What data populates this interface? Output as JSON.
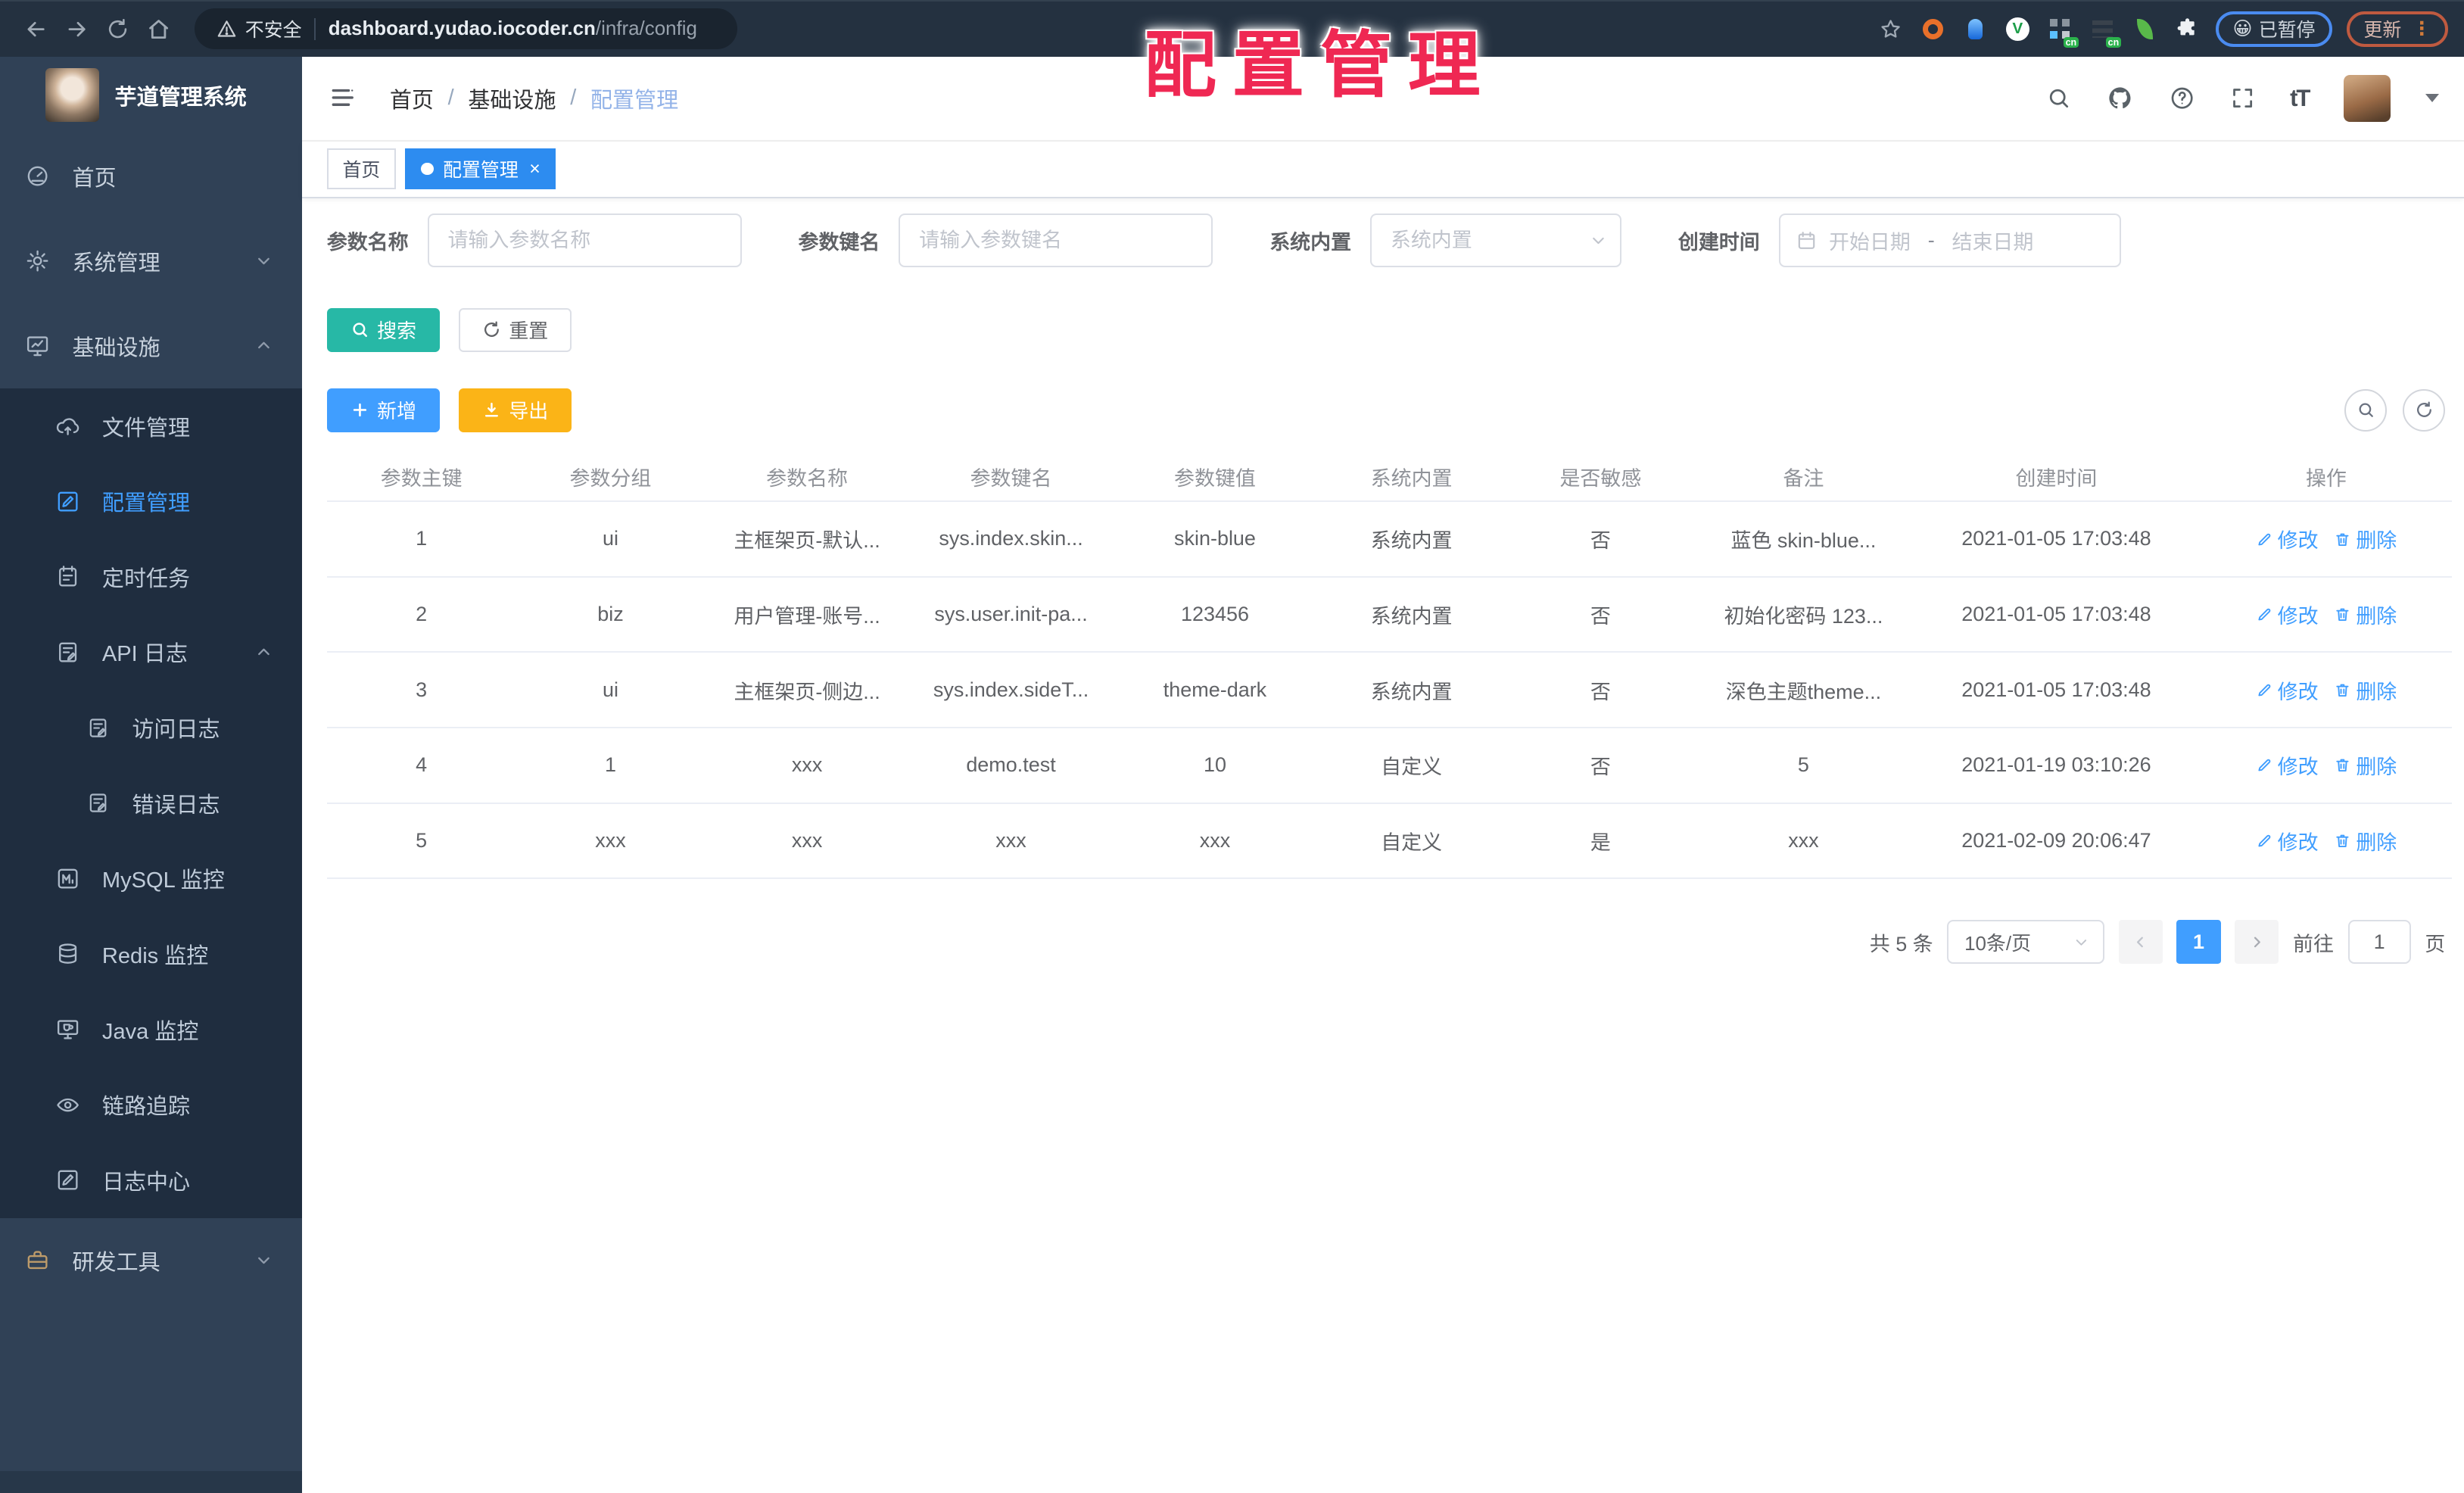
{
  "browser": {
    "insecure_label": "不安全",
    "url_host": "dashboard.yudao.iocoder.cn",
    "url_path": "/infra/config",
    "paused_badge": {
      "emoji": "😀",
      "label": "已暂停"
    },
    "update_button": {
      "label": "更新",
      "kebab": "⋮"
    },
    "extension_icons": [
      "bookmark-star",
      "orange-ring",
      "blue-pin",
      "green-check-circle",
      "grid-cn",
      "list-cn",
      "green-leaf",
      "puzzle"
    ]
  },
  "overlay_title": "配置管理",
  "sidebar": {
    "app_title": "芋道管理系统",
    "items": [
      {
        "label": "首页"
      },
      {
        "label": "系统管理"
      },
      {
        "label": "基础设施"
      },
      {
        "label": "文件管理"
      },
      {
        "label": "配置管理"
      },
      {
        "label": "定时任务"
      },
      {
        "label": "API 日志"
      },
      {
        "label": "访问日志"
      },
      {
        "label": "错误日志"
      },
      {
        "label": "MySQL 监控"
      },
      {
        "label": "Redis 监控"
      },
      {
        "label": "Java 监控"
      },
      {
        "label": "链路追踪"
      },
      {
        "label": "日志中心"
      },
      {
        "label": "研发工具"
      }
    ]
  },
  "header": {
    "breadcrumb": {
      "items": [
        "首页",
        "基础设施",
        "配置管理"
      ],
      "separator": "/"
    },
    "font_size_label": "tT"
  },
  "tabs": [
    {
      "label": "首页"
    },
    {
      "label": "配置管理",
      "close_glyph": "×"
    }
  ],
  "filters": {
    "param_name": {
      "label": "参数名称",
      "placeholder": "请输入参数名称"
    },
    "param_key": {
      "label": "参数键名",
      "placeholder": "请输入参数键名"
    },
    "builtin": {
      "label": "系统内置",
      "placeholder": "系统内置"
    },
    "create_time": {
      "label": "创建时间",
      "start_placeholder": "开始日期",
      "separator": "-",
      "end_placeholder": "结束日期"
    }
  },
  "toolbar": {
    "search_label": "搜索",
    "reset_label": "重置",
    "add_label": "新增",
    "export_label": "导出"
  },
  "table": {
    "columns": [
      "参数主键",
      "参数分组",
      "参数名称",
      "参数键名",
      "参数键值",
      "系统内置",
      "是否敏感",
      "备注",
      "创建时间",
      "操作"
    ],
    "rows": [
      [
        "1",
        "ui",
        "主框架页-默认...",
        "sys.index.skin...",
        "skin-blue",
        "系统内置",
        "否",
        "蓝色 skin-blue...",
        "2021-01-05 17:03:48"
      ],
      [
        "2",
        "biz",
        "用户管理-账号...",
        "sys.user.init-pa...",
        "123456",
        "系统内置",
        "否",
        "初始化密码 123...",
        "2021-01-05 17:03:48"
      ],
      [
        "3",
        "ui",
        "主框架页-侧边...",
        "sys.index.sideT...",
        "theme-dark",
        "系统内置",
        "否",
        "深色主题theme...",
        "2021-01-05 17:03:48"
      ],
      [
        "4",
        "1",
        "xxx",
        "demo.test",
        "10",
        "自定义",
        "否",
        "5",
        "2021-01-19 03:10:26"
      ],
      [
        "5",
        "xxx",
        "xxx",
        "xxx",
        "xxx",
        "自定义",
        "是",
        "xxx",
        "2021-02-09 20:06:47"
      ]
    ],
    "action_edit": "修改",
    "action_delete": "删除"
  },
  "pagination": {
    "total": "共 5 条",
    "page_size": "10条/页",
    "current_page": "1",
    "goto_label": "前往",
    "goto_value": "1",
    "page_suffix": "页"
  },
  "colors": {
    "accent": "#409eff",
    "teal": "#27b8a6",
    "warning": "#fbb417",
    "tab_active": "#2d8cf0",
    "title_red": "#ef2853"
  }
}
